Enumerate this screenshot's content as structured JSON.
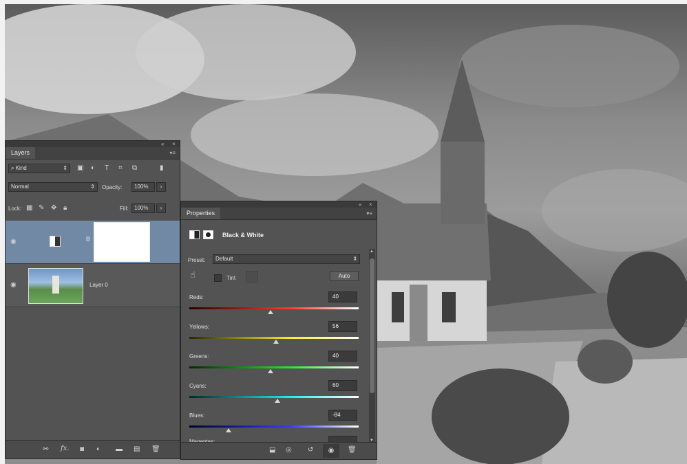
{
  "layers_panel": {
    "tab_label": "Layers",
    "filter_label": "Kind",
    "blend_mode": "Normal",
    "opacity_label": "Opacity:",
    "opacity_value": "100%",
    "lock_label": "Lock:",
    "fill_label": "Fill:",
    "fill_value": "100%",
    "layers": [
      {
        "name": "",
        "type": "adjustment",
        "selected": true
      },
      {
        "name": "Layer 0",
        "type": "image",
        "selected": false
      }
    ]
  },
  "properties_panel": {
    "tab_label": "Properties",
    "adjustment_title": "Black & White",
    "preset_label": "Preset:",
    "preset_value": "Default",
    "tint_label": "Tint",
    "auto_button": "Auto",
    "sliders": [
      {
        "label": "Reds:",
        "value": 40,
        "colors": [
          "#2a0000",
          "#ff3b2a"
        ]
      },
      {
        "label": "Yellows:",
        "value": 56,
        "colors": [
          "#2a2600",
          "#ffee22"
        ]
      },
      {
        "label": "Greens:",
        "value": 40,
        "colors": [
          "#002a00",
          "#22ee22"
        ]
      },
      {
        "label": "Cyans:",
        "value": 60,
        "colors": [
          "#002a2a",
          "#22eeee"
        ]
      },
      {
        "label": "Blues:",
        "value": -84,
        "colors": [
          "#00002a",
          "#3a3aff"
        ]
      }
    ],
    "next_slider_label": "Magentas:"
  }
}
